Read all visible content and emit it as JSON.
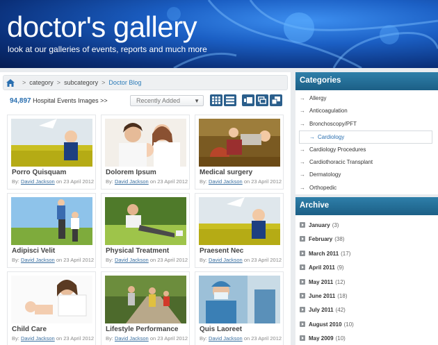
{
  "banner": {
    "title": "doctor's gallery",
    "subtitle": "look at our galleries of events, reports and much more"
  },
  "breadcrumb": {
    "items": [
      "category",
      "subcategory",
      "Doctor Blog"
    ],
    "separator": ">"
  },
  "toolbar": {
    "count": "94,897",
    "count_label": "Hospital Events Images",
    "count_suffix": ">>",
    "sort_value": "Recently Added"
  },
  "byline": {
    "prefix": "By:",
    "author": "David Jackson",
    "middle": "on",
    "date": "23 April 2012"
  },
  "cards": [
    {
      "title": "Porro Quisquam"
    },
    {
      "title": "Dolorem Ipsum"
    },
    {
      "title": "Medical surgery"
    },
    {
      "title": "Adipisci Velit"
    },
    {
      "title": "Physical Treatment"
    },
    {
      "title": "Praesent Nec"
    },
    {
      "title": "Child Care"
    },
    {
      "title": "Lifestyle Performance"
    },
    {
      "title": "Quis Laoreet"
    }
  ],
  "categories": {
    "heading": "Categories",
    "items": [
      {
        "label": "Allergy"
      },
      {
        "label": "Anticoagulation"
      },
      {
        "label": "Bronchoscopy/PFT"
      },
      {
        "label": "Cardiology",
        "selected": true
      },
      {
        "label": "Cardiology Procedures"
      },
      {
        "label": "Cardiothoracic Transplant"
      },
      {
        "label": "Dermatology"
      },
      {
        "label": "Orthopedic"
      }
    ]
  },
  "archive": {
    "heading": "Archive",
    "items": [
      {
        "label": "January",
        "count": "(3)"
      },
      {
        "label": "February",
        "count": "(38)"
      },
      {
        "label": "March 2011",
        "count": "(17)"
      },
      {
        "label": "April 2011",
        "count": "(9)"
      },
      {
        "label": "May 2011",
        "count": "(12)"
      },
      {
        "label": "June 2011",
        "count": "(18)"
      },
      {
        "label": "July 2011",
        "count": "(42)"
      },
      {
        "label": "August 2010",
        "count": "(10)"
      },
      {
        "label": "May 2009",
        "count": "(10)"
      }
    ]
  },
  "colors": {
    "accent": "#2a6fb0",
    "panel_header": "#1c5f86",
    "banner": "#1b5fc4"
  }
}
